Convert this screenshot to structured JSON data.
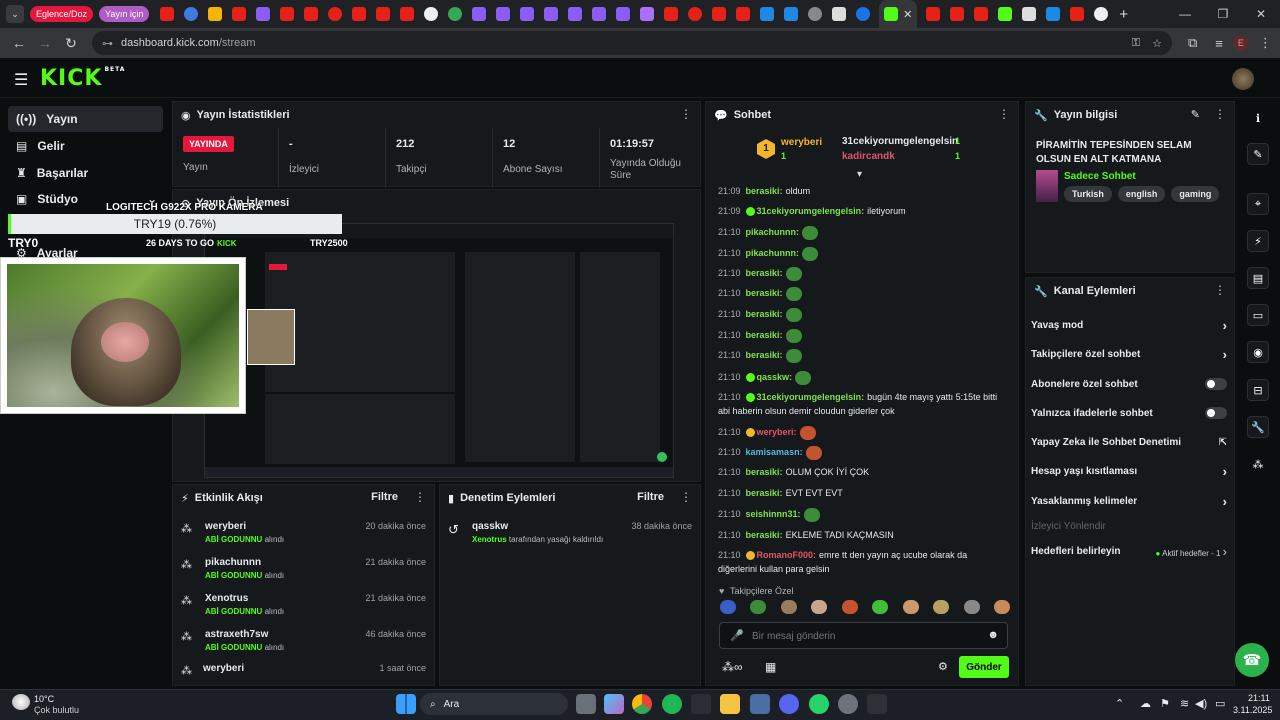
{
  "browser": {
    "tabs_pinned": [
      "Eglence/Doz",
      "Yayın için"
    ],
    "address": "dashboard.kick.com",
    "address_path": "/stream",
    "profile_initial": "E"
  },
  "nav": {
    "items": [
      "Yayın",
      "Gelir",
      "Başarılar",
      "Stüdyo",
      "Ayarlar"
    ]
  },
  "stats": {
    "title": "Yayın İstatistikleri",
    "live_badge": "YAYINDA",
    "live_label": "Yayın",
    "viewers_value": "-",
    "viewers_label": "İzleyici",
    "followers_value": "212",
    "followers_label": "Takipçi",
    "subs_value": "12",
    "subs_label": "Abone Sayısı",
    "uptime_value": "01:19:57",
    "uptime_label": "Yayında Olduğu Süre"
  },
  "preview": {
    "title": "Yayın Ön İzlemesi"
  },
  "overlay": {
    "camera": "LOGITECH G922X PRO KAMERA",
    "goal": "TRY19 (0.76%)",
    "left_label": "TRY0",
    "days": "26 DAYS TO GO",
    "right_label": "TRY2500"
  },
  "activity": {
    "title": "Etkinlik Akışı",
    "filter": "Filtre",
    "rows": [
      {
        "name": "weryberi",
        "action": "ABİ GODUNNU",
        "suffix": "alındı",
        "time": "20 dakika önce"
      },
      {
        "name": "pikachunnn",
        "action": "ABİ GODUNNU",
        "suffix": "alındı",
        "time": "21 dakika önce"
      },
      {
        "name": "Xenotrus",
        "action": "ABİ GODUNNU",
        "suffix": "alındı",
        "time": "21 dakika önce"
      },
      {
        "name": "astraxeth7sw",
        "action": "ABİ GODUNNU",
        "suffix": "alındı",
        "time": "46 dakika önce"
      },
      {
        "name": "weryberi",
        "action": "",
        "suffix": "",
        "time": "1 saat önce"
      }
    ]
  },
  "moderation": {
    "title": "Denetim Eylemleri",
    "filter": "Filtre",
    "rows": [
      {
        "name": "qasskw",
        "actor": "Xenotrus",
        "text": "tarafından yasağı kaldırıldı",
        "time": "38 dakika önce"
      }
    ]
  },
  "chat": {
    "title": "Sohbet",
    "top": [
      {
        "rank": "1",
        "name": "weryberi",
        "count": "1"
      },
      {
        "name": "31cekiyorumgelengelsin",
        "count": "1"
      },
      {
        "name": "kadircandk",
        "count": "1"
      }
    ],
    "messages": [
      {
        "time": "21:09",
        "user": "berasiki:",
        "text": "oldum",
        "color": "#7ee14b"
      },
      {
        "time": "21:09",
        "user": "31cekiyorumgelengelsin:",
        "text": "iletiyorum",
        "color": "#7ee14b"
      },
      {
        "time": "21:10",
        "user": "pikachunnn:",
        "text": "",
        "color": "#7ee14b"
      },
      {
        "time": "21:10",
        "user": "pikachunnn:",
        "text": "",
        "color": "#7ee14b"
      },
      {
        "time": "21:10",
        "user": "berasiki:",
        "text": "",
        "color": "#7ee14b"
      },
      {
        "time": "21:10",
        "user": "berasiki:",
        "text": "",
        "color": "#7ee14b"
      },
      {
        "time": "21:10",
        "user": "berasiki:",
        "text": "",
        "color": "#7ee14b"
      },
      {
        "time": "21:10",
        "user": "berasiki:",
        "text": "",
        "color": "#7ee14b"
      },
      {
        "time": "21:10",
        "user": "berasiki:",
        "text": "",
        "color": "#7ee14b"
      },
      {
        "time": "21:10",
        "user": "qasskw:",
        "text": "",
        "color": "#7ee14b"
      },
      {
        "time": "21:10",
        "user": "31cekiyorumgelengelsin:",
        "text": "bugün 4te mayış yattı 5:15te bitti abi haberin olsun demir cloudun giderler çok",
        "color": "#7ee14b"
      },
      {
        "time": "21:10",
        "user": "weryberi:",
        "text": "",
        "color": "#e0546a"
      },
      {
        "time": "21:10",
        "user": "kamisamasn:",
        "text": "",
        "color": "#52b7e0"
      },
      {
        "time": "21:10",
        "user": "berasiki:",
        "text": "OLUM ÇOK İYİ ÇOK",
        "color": "#7ee14b"
      },
      {
        "time": "21:10",
        "user": "berasiki:",
        "text": "EVT EVT EVT",
        "color": "#7ee14b"
      },
      {
        "time": "21:10",
        "user": "seishinnn31:",
        "text": "",
        "color": "#7ee14b"
      },
      {
        "time": "21:10",
        "user": "berasiki:",
        "text": "EKLEME TADI KAÇMASIN",
        "color": "#7ee14b"
      },
      {
        "time": "21:10",
        "user": "RomanoF000:",
        "text": "emre tt den yayın aç ucube olarak da diğerlerini kullan para gelsin",
        "color": "#e0546a"
      }
    ],
    "followers_only": "Takipçilere Özel",
    "placeholder": "Bir mesaj gönderin",
    "send": "Gönder"
  },
  "stream_info": {
    "title": "Yayın bilgisi",
    "stream_title": "PİRAMİTİN TEPESİNDEN SELAM OLSUN EN ALT KATMANA",
    "category": "Sadece Sohbet",
    "tags": [
      "Turkish",
      "english",
      "gaming"
    ]
  },
  "channel_actions": {
    "title": "Kanal Eylemleri",
    "items": [
      {
        "label": "Yavaş mod",
        "kind": "arrow"
      },
      {
        "label": "Takipçilere özel sohbet",
        "kind": "arrow"
      },
      {
        "label": "Abonelere özel sohbet",
        "kind": "toggle"
      },
      {
        "label": "Yalnızca ifadelerle sohbet",
        "kind": "toggle"
      },
      {
        "label": "Yapay Zeka ile Sohbet Denetimi",
        "kind": "external"
      },
      {
        "label": "Hesap yaşı kısıtlaması",
        "kind": "arrow"
      },
      {
        "label": "Yasaklanmış kelimeler",
        "kind": "arrow"
      },
      {
        "label": "İzleyici Yönlendir",
        "kind": "disabled"
      },
      {
        "label": "Hedefleri belirleyin",
        "kind": "status"
      }
    ],
    "goals_status": "Aktif hedefler - 1"
  },
  "taskbar": {
    "weather_temp": "10°C",
    "weather_desc": "Çok bulutlu",
    "search": "Ara",
    "time": "21:11",
    "date": "3.11.2025"
  },
  "colors": {
    "kick_green": "#53fc18",
    "live_red": "#e5173f",
    "panel": "#16191c"
  }
}
